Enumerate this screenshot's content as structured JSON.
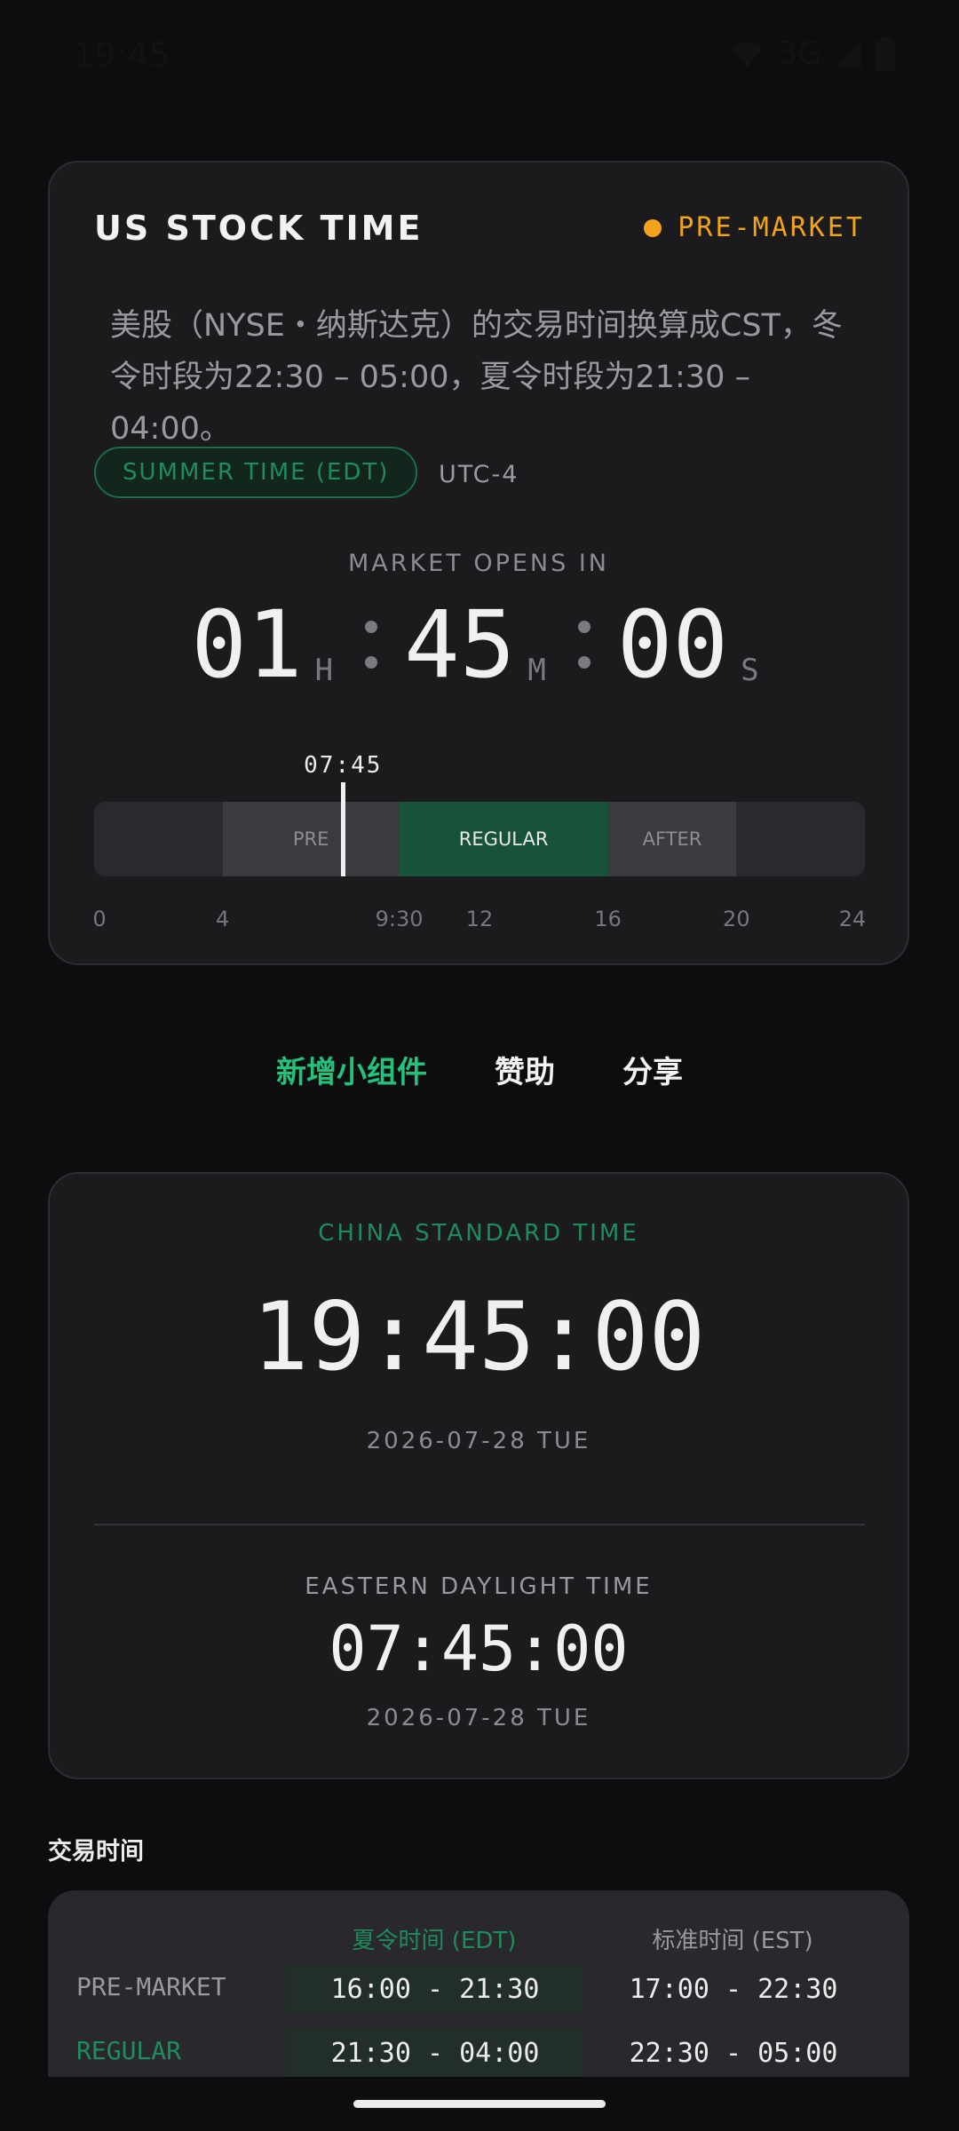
{
  "status_bar": {
    "time": "19:45",
    "network": "3G"
  },
  "us_card": {
    "title": "US STOCK TIME",
    "status": "PRE-MARKET",
    "description": "美股（NYSE・纳斯达克）的交易时间换算成CST，冬令时段为22:30 – 05:00，夏令时段为21:30 – 04:00。",
    "dst_badge": "SUMMER TIME (EDT)",
    "utc_offset": "UTC-4",
    "opens_label": "MARKET OPENS IN",
    "countdown": {
      "hours": "01",
      "hours_unit": "H",
      "minutes": "45",
      "minutes_unit": "M",
      "seconds": "00",
      "seconds_unit": "S"
    },
    "timeline": {
      "now_label": "07:45",
      "now_hour": 7.75,
      "segments": [
        {
          "label": "PRE",
          "start": 4,
          "end": 9.5
        },
        {
          "label": "REGULAR",
          "start": 9.5,
          "end": 16
        },
        {
          "label": "AFTER",
          "start": 16,
          "end": 20
        }
      ],
      "ticks": [
        {
          "label": "0",
          "hour": 0
        },
        {
          "label": "4",
          "hour": 4
        },
        {
          "label": "9:30",
          "hour": 9.5
        },
        {
          "label": "12",
          "hour": 12
        },
        {
          "label": "16",
          "hour": 16
        },
        {
          "label": "20",
          "hour": 20
        },
        {
          "label": "24",
          "hour": 24
        }
      ]
    }
  },
  "links": {
    "add_widget": "新增小组件",
    "sponsor": "赞助",
    "share": "分享"
  },
  "clock_card": {
    "cst_label": "CHINA STANDARD TIME",
    "cst_time": "19:45:00",
    "cst_date": "2026-07-28 TUE",
    "edt_label": "EASTERN DAYLIGHT TIME",
    "edt_time": "07:45:00",
    "edt_date": "2026-07-28 TUE"
  },
  "trading_hours": {
    "title": "交易时间",
    "col_edt": "夏令时间 (EDT)",
    "col_est": "标准时间 (EST)",
    "rows": [
      {
        "label": "PRE-MARKET",
        "edt": "16:00 - 21:30",
        "est": "17:00 - 22:30"
      },
      {
        "label": "REGULAR",
        "edt": "21:30 - 04:00",
        "est": "22:30 - 05:00"
      }
    ]
  },
  "colors": {
    "accent_green": "#22c27a",
    "premarket_orange": "#f3a31b",
    "regular_green": "#17523b"
  }
}
